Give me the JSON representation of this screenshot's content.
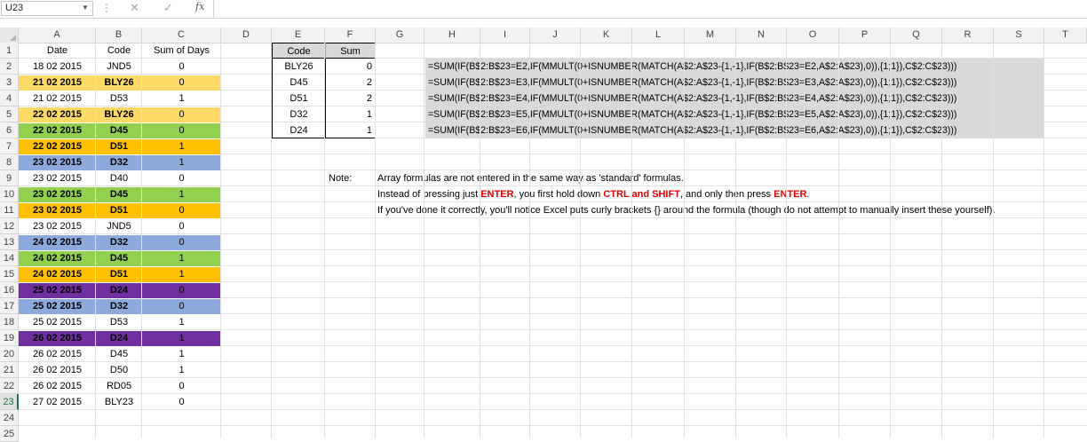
{
  "formula_bar": {
    "name_box": "U23",
    "fx_label": "fx",
    "formula": ""
  },
  "columns": [
    "A",
    "B",
    "C",
    "D",
    "E",
    "F",
    "G",
    "H",
    "I",
    "J",
    "K",
    "L",
    "M",
    "N",
    "O",
    "P",
    "Q",
    "R",
    "S",
    "T"
  ],
  "rows": [
    "1",
    "2",
    "3",
    "4",
    "5",
    "6",
    "7",
    "8",
    "9",
    "10",
    "11",
    "12",
    "13",
    "14",
    "15",
    "16",
    "17",
    "18",
    "19",
    "20",
    "21",
    "22",
    "23",
    "24",
    "25"
  ],
  "table_left": {
    "headers": [
      "Date",
      "Code",
      "Sum of Days"
    ],
    "rows": [
      {
        "date": "18 02 2015",
        "code": "JND5",
        "sum": "0",
        "fill": "none",
        "bold": false
      },
      {
        "date": "21 02 2015",
        "code": "BLY26",
        "sum": "0",
        "fill": "yellow",
        "bold": true
      },
      {
        "date": "21 02 2015",
        "code": "D53",
        "sum": "1",
        "fill": "none",
        "bold": false
      },
      {
        "date": "22 02 2015",
        "code": "BLY26",
        "sum": "0",
        "fill": "yellow",
        "bold": true
      },
      {
        "date": "22 02 2015",
        "code": "D45",
        "sum": "0",
        "fill": "green",
        "bold": true
      },
      {
        "date": "22 02 2015",
        "code": "D51",
        "sum": "1",
        "fill": "orange",
        "bold": true
      },
      {
        "date": "23 02 2015",
        "code": "D32",
        "sum": "1",
        "fill": "blue",
        "bold": true
      },
      {
        "date": "23 02 2015",
        "code": "D40",
        "sum": "0",
        "fill": "none",
        "bold": false
      },
      {
        "date": "23 02 2015",
        "code": "D45",
        "sum": "1",
        "fill": "green",
        "bold": true
      },
      {
        "date": "23 02 2015",
        "code": "D51",
        "sum": "0",
        "fill": "orange",
        "bold": true
      },
      {
        "date": "23 02 2015",
        "code": "JND5",
        "sum": "0",
        "fill": "none",
        "bold": false
      },
      {
        "date": "24 02 2015",
        "code": "D32",
        "sum": "0",
        "fill": "blue",
        "bold": true
      },
      {
        "date": "24 02 2015",
        "code": "D45",
        "sum": "1",
        "fill": "green",
        "bold": true
      },
      {
        "date": "24 02 2015",
        "code": "D51",
        "sum": "1",
        "fill": "orange",
        "bold": true
      },
      {
        "date": "25 02 2015",
        "code": "D24",
        "sum": "0",
        "fill": "purple",
        "bold": true
      },
      {
        "date": "25 02 2015",
        "code": "D32",
        "sum": "0",
        "fill": "blue",
        "bold": true
      },
      {
        "date": "25 02 2015",
        "code": "D53",
        "sum": "1",
        "fill": "none",
        "bold": false
      },
      {
        "date": "26 02 2015",
        "code": "D24",
        "sum": "1",
        "fill": "purple",
        "bold": true
      },
      {
        "date": "26 02 2015",
        "code": "D45",
        "sum": "1",
        "fill": "none",
        "bold": false
      },
      {
        "date": "26 02 2015",
        "code": "D50",
        "sum": "1",
        "fill": "none",
        "bold": false
      },
      {
        "date": "26 02 2015",
        "code": "RD05",
        "sum": "0",
        "fill": "none",
        "bold": false
      },
      {
        "date": "27 02 2015",
        "code": "BLY23",
        "sum": "0",
        "fill": "none",
        "bold": false
      }
    ]
  },
  "table_right": {
    "headers": [
      "Code",
      "Sum"
    ],
    "rows": [
      {
        "code": "BLY26",
        "sum": "0"
      },
      {
        "code": "D45",
        "sum": "2"
      },
      {
        "code": "D51",
        "sum": "2"
      },
      {
        "code": "D32",
        "sum": "1"
      },
      {
        "code": "D24",
        "sum": "1"
      }
    ]
  },
  "formulas": [
    "=SUM(IF(B$2:B$23=E2,IF(MMULT(0+ISNUMBER(MATCH(A$2:A$23-{1,-1},IF(B$2:B$23=E2,A$2:A$23),0)),{1;1}),C$2:C$23)))",
    "=SUM(IF(B$2:B$23=E3,IF(MMULT(0+ISNUMBER(MATCH(A$2:A$23-{1,-1},IF(B$2:B$23=E3,A$2:A$23),0)),{1;1}),C$2:C$23)))",
    "=SUM(IF(B$2:B$23=E4,IF(MMULT(0+ISNUMBER(MATCH(A$2:A$23-{1,-1},IF(B$2:B$23=E4,A$2:A$23),0)),{1;1}),C$2:C$23)))",
    "=SUM(IF(B$2:B$23=E5,IF(MMULT(0+ISNUMBER(MATCH(A$2:A$23-{1,-1},IF(B$2:B$23=E5,A$2:A$23),0)),{1;1}),C$2:C$23)))",
    "=SUM(IF(B$2:B$23=E6,IF(MMULT(0+ISNUMBER(MATCH(A$2:A$23-{1,-1},IF(B$2:B$23=E6,A$2:A$23),0)),{1;1}),C$2:C$23)))"
  ],
  "note": {
    "label": "Note:",
    "line1": "Array formulas are not entered in the same way as 'standard' formulas.",
    "line2_a": "Instead of pressing just ",
    "line2_b": "ENTER",
    "line2_c": ", you first hold down ",
    "line2_d": "CTRL and SHIFT",
    "line2_e": ", and only then press ",
    "line2_f": "ENTER",
    "line2_g": ".",
    "line3": "If you've done it correctly, you'll notice Excel puts curly brackets {} around the formula (though do not attempt to manually insert these yourself)."
  },
  "colors": {
    "yellow": "#ffd966",
    "green": "#92d050",
    "orange": "#ffc000",
    "blue": "#8ea9db",
    "purple": "#7030a0",
    "formula_fill": "#d9d9d9",
    "excel_green": "#217346"
  },
  "icons": {
    "cancel": "cross-icon",
    "enter": "check-icon",
    "function": "fx-icon"
  }
}
